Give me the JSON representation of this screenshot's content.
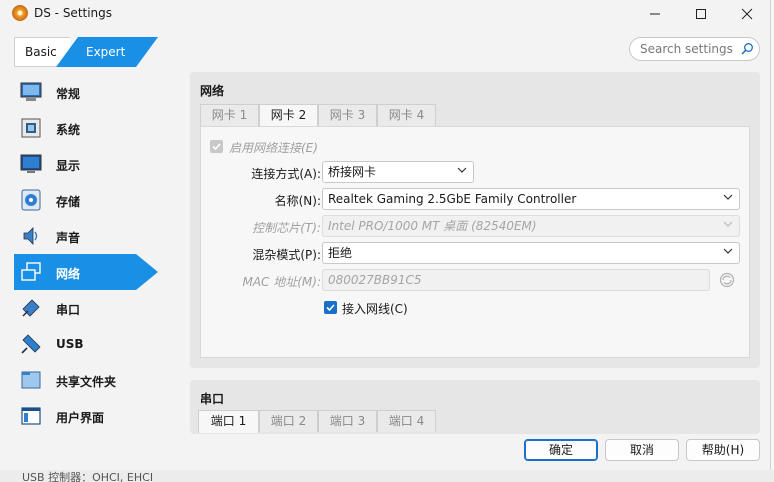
{
  "window": {
    "title": "DS - Settings",
    "minimize": "—",
    "maximize": "☐",
    "close": "✕"
  },
  "mode": {
    "basic": "Basic",
    "expert": "Expert"
  },
  "search": {
    "placeholder": "Search settings"
  },
  "sidebar": {
    "items": [
      {
        "label": "常规",
        "icon": "general-icon"
      },
      {
        "label": "系统",
        "icon": "system-icon"
      },
      {
        "label": "显示",
        "icon": "display-icon"
      },
      {
        "label": "存储",
        "icon": "storage-icon"
      },
      {
        "label": "声音",
        "icon": "audio-icon"
      },
      {
        "label": "网络",
        "icon": "network-icon",
        "active": true
      },
      {
        "label": "串口",
        "icon": "serial-icon"
      },
      {
        "label": "USB",
        "icon": "usb-icon"
      },
      {
        "label": "共享文件夹",
        "icon": "shared-folder-icon"
      },
      {
        "label": "用户界面",
        "icon": "user-interface-icon"
      }
    ]
  },
  "network": {
    "title": "网络",
    "tabs": [
      {
        "label": "网卡 1",
        "active": false
      },
      {
        "label": "网卡 2",
        "active": true
      },
      {
        "label": "网卡 3",
        "active": false
      },
      {
        "label": "网卡 4",
        "active": false
      }
    ],
    "enable_label": "启用网络连接(E)",
    "attached_label": "连接方式(A):",
    "attached_value": "桥接网卡",
    "name_label": "名称(N):",
    "name_value": "Realtek Gaming 2.5GbE Family Controller",
    "adapter_label": "控制芯片(T):",
    "adapter_value": "Intel PRO/1000 MT 桌面 (82540EM)",
    "promisc_label": "混杂模式(P):",
    "promisc_value": "拒绝",
    "mac_label": "MAC 地址(M):",
    "mac_value": "080027BB91C5",
    "cable_label": "接入网线(C)",
    "cable_checked": true
  },
  "serial": {
    "title": "串口",
    "tabs": [
      {
        "label": "端口 1",
        "active": true
      },
      {
        "label": "端口 2",
        "active": false
      },
      {
        "label": "端口 3",
        "active": false
      },
      {
        "label": "端口 4",
        "active": false
      }
    ]
  },
  "buttons": {
    "ok": "确定",
    "cancel": "取消",
    "help": "帮助(H)"
  },
  "underlay_text": "USB 控制器：OHCI, EHCI",
  "colors": {
    "accent": "#1a8fe6",
    "checkbox": "#1a6fc9"
  }
}
